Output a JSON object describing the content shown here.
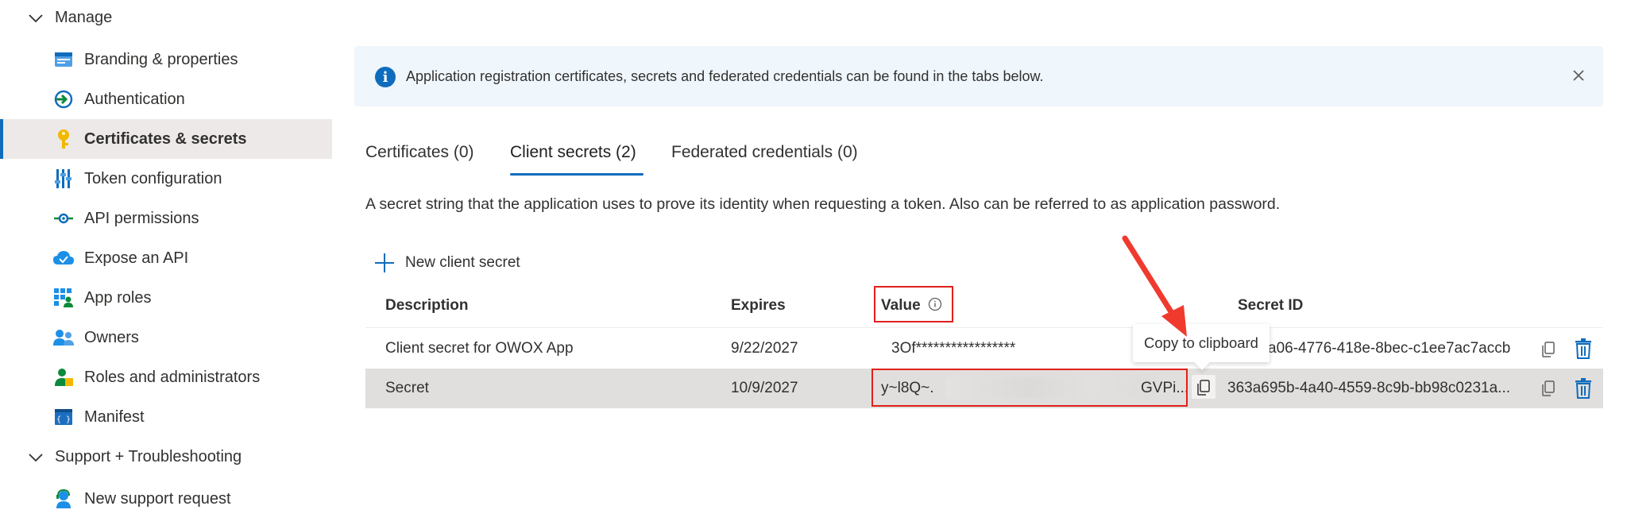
{
  "sidebar": {
    "manage_label": "Manage",
    "items": [
      {
        "label": "Branding & properties",
        "icon": "branding-icon"
      },
      {
        "label": "Authentication",
        "icon": "authentication-icon"
      },
      {
        "label": "Certificates & secrets",
        "icon": "key-icon",
        "active": true
      },
      {
        "label": "Token configuration",
        "icon": "token-config-icon"
      },
      {
        "label": "API permissions",
        "icon": "api-permissions-icon"
      },
      {
        "label": "Expose an API",
        "icon": "cloud-icon"
      },
      {
        "label": "App roles",
        "icon": "app-roles-icon"
      },
      {
        "label": "Owners",
        "icon": "owners-icon"
      },
      {
        "label": "Roles and administrators",
        "icon": "roles-admin-icon"
      },
      {
        "label": "Manifest",
        "icon": "manifest-icon"
      }
    ],
    "support_label": "Support + Troubleshooting",
    "support_items": [
      {
        "label": "New support request",
        "icon": "support-agent-icon"
      }
    ]
  },
  "banner": {
    "message": "Application registration certificates, secrets and federated credentials can be found in the tabs below."
  },
  "tabs": [
    {
      "label": "Certificates (0)"
    },
    {
      "label": "Client secrets (2)",
      "active": true
    },
    {
      "label": "Federated credentials (0)"
    }
  ],
  "description": "A secret string that the application uses to prove its identity when requesting a token. Also can be referred to as application password.",
  "new_secret_label": "New client secret",
  "table": {
    "headers": {
      "description": "Description",
      "expires": "Expires",
      "value": "Value",
      "secret_id": "Secret ID"
    },
    "rows": [
      {
        "description": "Client secret for OWOX App",
        "expires": "9/22/2027",
        "value": "3Of*****************",
        "secret_id": "a06-4776-418e-8bec-c1ee7ac7accb"
      },
      {
        "description": "Secret",
        "expires": "10/9/2027",
        "value_start": "y~l8Q~.",
        "value_end": "GVPi...",
        "secret_id": "363a695b-4a40-4559-8c9b-bb98c0231a..."
      }
    ]
  },
  "tooltip": "Copy to clipboard",
  "colors": {
    "accent": "#0f6cbd",
    "highlight_red": "#e0201b",
    "selected_row": "#e1dfdd"
  }
}
